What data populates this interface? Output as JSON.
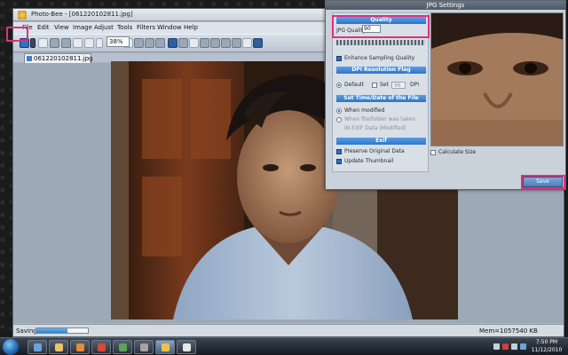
{
  "app": {
    "title": "Photo-Bee - [061220102811.jpg]",
    "menu": [
      "File",
      "Edit",
      "View",
      "Image",
      "Adjust",
      "Tools",
      "Filters",
      "Window",
      "Help"
    ],
    "zoom_value": "38%",
    "tab_label": "061220102811.jpg",
    "status_text": "Saving",
    "save_progress": 0.6,
    "memory_text": "Mem=1057540 KB"
  },
  "dialog": {
    "title": "JPG Settings",
    "quality_header": "Quality",
    "quality_label": "JPG Quality",
    "quality_value": "90",
    "enhance_label": "Enhance Sampling Quality",
    "dpi_header": "DPI Resolution Flag",
    "dpi_default_label": "Default",
    "dpi_set_label": "Set",
    "dpi_value": "96",
    "dpi_unit": "DPI",
    "time_header": "Set Time/Date of the File",
    "time_options": [
      "When modified",
      "When file/folder was taken",
      "IN EXIF Data (Modified)"
    ],
    "exif_header": "Exif",
    "exif_preserve_label": "Preserve Original Data",
    "exif_thumbnail_label": "Update Thumbnail",
    "calc_size_label": "Calculate Size",
    "save_button": "Save"
  },
  "taskbar": {
    "time": "7:50 PM",
    "date": "11/12/2010"
  },
  "icons": {
    "start": "windows-start-orb",
    "save": "floppy-disk-icon",
    "tray": [
      "flag-icon",
      "network-icon",
      "volume-icon"
    ]
  },
  "colors": {
    "highlight": "#e0307f",
    "section_header": "#2d74c8",
    "app_background": "#a9b4c2"
  }
}
